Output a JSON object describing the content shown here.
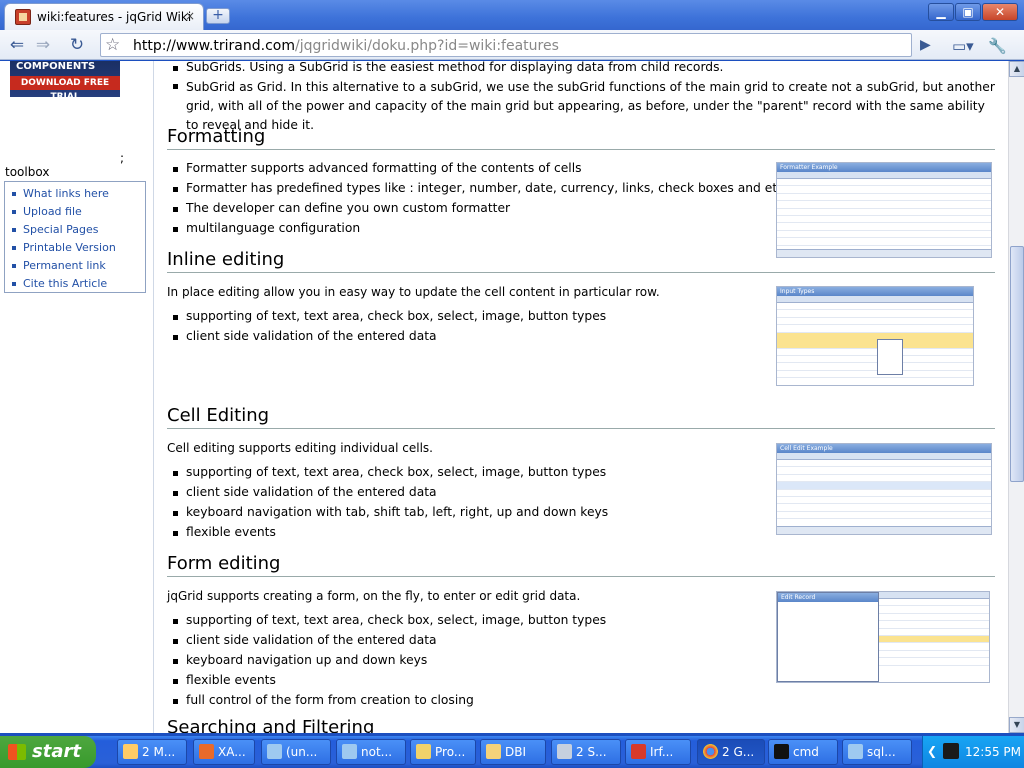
{
  "browser": {
    "tab_title": "wiki:features - jqGrid Wiki",
    "tab_close": "×",
    "new_tab": "+",
    "url_domain": "http://www.trirand.com",
    "url_path": "/jqgridwiki/doku.php?id=wiki:features",
    "win_min": "▁",
    "win_max": "▣",
    "win_close": "✕"
  },
  "sidebar": {
    "ad_text": "COMPONENTS",
    "ad_button": "DOWNLOAD FREE TRIAL",
    "semicolon": ";",
    "toolbox_title": "toolbox",
    "toolbox": [
      {
        "label": "What links here"
      },
      {
        "label": "Upload file"
      },
      {
        "label": "Special Pages"
      },
      {
        "label": "Printable Version"
      },
      {
        "label": "Permanent link"
      },
      {
        "label": "Cite this Article"
      }
    ]
  },
  "content": {
    "top_items": [
      "SubGrids. Using a SubGrid is the easiest method for displaying data from child records.",
      "SubGrid as Grid. In this alternative to a subGrid, we use the subGrid functions of the main grid to create not a subGrid, but another grid, with all of the power and capacity of the main grid but appearing, as before, under the \"parent\" record with the same ability to reveal and hide it."
    ],
    "formatting": {
      "heading": "Formatting",
      "items": [
        "Formatter supports advanced formatting of the contents of cells",
        "Formatter has predefined types like : integer, number, date, currency, links, check boxes and etc.",
        "The developer can define you own custom formatter",
        "multilanguage configuration"
      ],
      "thumb_caption": "Formatter Example"
    },
    "inline": {
      "heading": "Inline editing",
      "intro": "In place editing allow you in easy way to update the cell content in particular row.",
      "items": [
        "supporting of text, text area, check box, select, image, button types",
        "client side validation of the entered data"
      ],
      "thumb_caption": "Input Types"
    },
    "cell": {
      "heading": "Cell Editing",
      "intro": "Cell editing supports editing individual cells.",
      "items": [
        "supporting of text, text area, check box, select, image, button types",
        "client side validation of the entered data",
        "keyboard navigation with tab, shift tab, left, right, up and down keys",
        "flexible events"
      ],
      "thumb_caption": "Cell Edit Example"
    },
    "form": {
      "heading": "Form editing",
      "intro": "jqGrid supports creating a form, on the fly, to enter or edit grid data.",
      "items": [
        "supporting of text, text area, check box, select, image, button types",
        "client side validation of the entered data",
        "keyboard navigation up and down keys",
        "flexible events",
        "full control of the form from creation to closing"
      ],
      "thumb_caption": "Edit Record"
    },
    "searching": {
      "heading": "Searching and Filtering"
    }
  },
  "taskbar": {
    "start": "start",
    "buttons": [
      {
        "label": "2 M..."
      },
      {
        "label": "XA..."
      },
      {
        "label": "(un..."
      },
      {
        "label": "not..."
      },
      {
        "label": "Pro..."
      },
      {
        "label": "DBI"
      },
      {
        "label": "2 S..."
      },
      {
        "label": "Irf..."
      },
      {
        "label": "2 G..."
      },
      {
        "label": "cmd"
      },
      {
        "label": "sql..."
      }
    ],
    "clock": "12:55 PM"
  }
}
